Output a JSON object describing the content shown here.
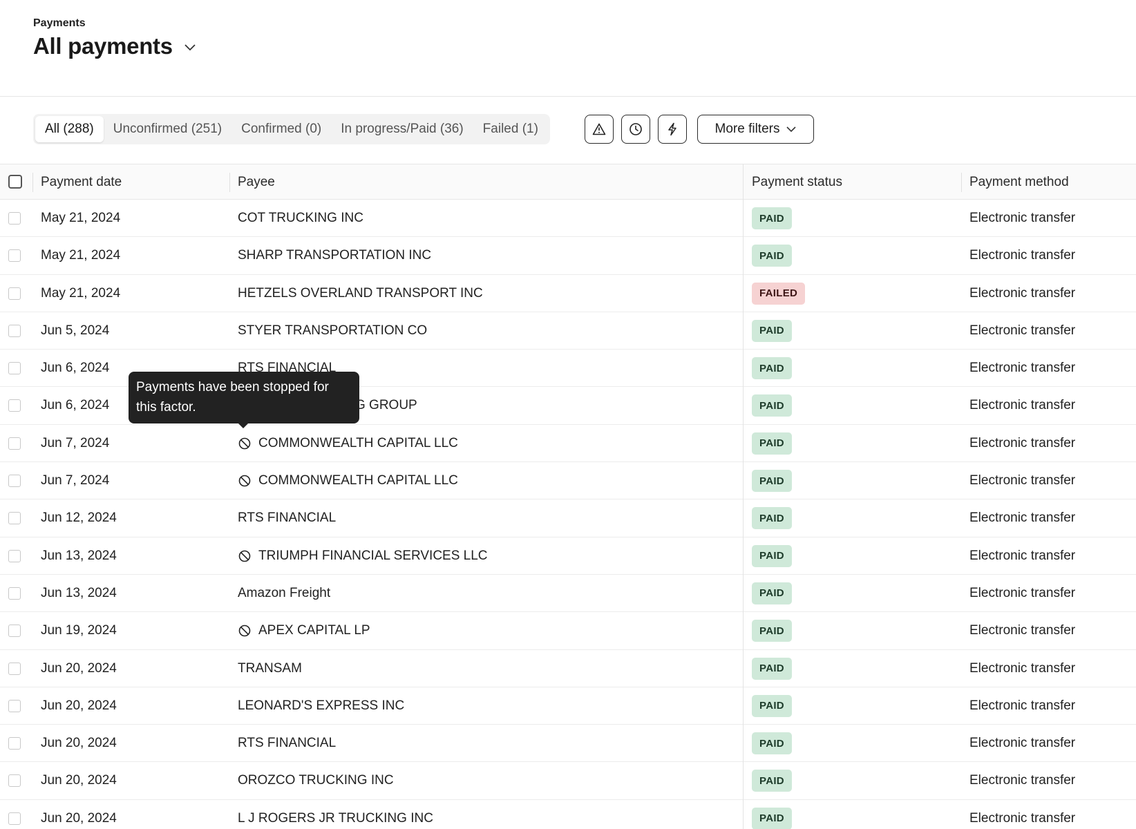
{
  "header": {
    "breadcrumb": "Payments",
    "title": "All payments"
  },
  "tabs": [
    {
      "label": "All (288)",
      "active": true
    },
    {
      "label": "Unconfirmed (251)",
      "active": false
    },
    {
      "label": "Confirmed (0)",
      "active": false
    },
    {
      "label": "In progress/Paid (36)",
      "active": false
    },
    {
      "label": "Failed (1)",
      "active": false
    }
  ],
  "filters": {
    "icons": [
      "warning-icon",
      "clock-icon",
      "bolt-icon"
    ],
    "more_filters_label": "More filters"
  },
  "table": {
    "columns": [
      "Payment date",
      "Payee",
      "Payment status",
      "Payment method"
    ],
    "rows": [
      {
        "date": "May 21, 2024",
        "payee": "COT TRUCKING INC",
        "stopped": false,
        "status": "PAID",
        "method": "Electronic transfer"
      },
      {
        "date": "May 21, 2024",
        "payee": "SHARP TRANSPORTATION INC",
        "stopped": false,
        "status": "PAID",
        "method": "Electronic transfer"
      },
      {
        "date": "May 21, 2024",
        "payee": "HETZELS OVERLAND TRANSPORT INC",
        "stopped": false,
        "status": "FAILED",
        "method": "Electronic transfer"
      },
      {
        "date": "Jun 5, 2024",
        "payee": "STYER TRANSPORTATION CO",
        "stopped": false,
        "status": "PAID",
        "method": "Electronic transfer"
      },
      {
        "date": "Jun 6, 2024",
        "payee": "RTS FINANCIAL",
        "stopped": false,
        "status": "PAID",
        "method": "Electronic transfer"
      },
      {
        "date": "Jun 6, 2024",
        "payee": "G GROUP",
        "stopped": false,
        "status": "PAID",
        "method": "Electronic transfer"
      },
      {
        "date": "Jun 7, 2024",
        "payee": "COMMONWEALTH CAPITAL LLC",
        "stopped": true,
        "status": "PAID",
        "method": "Electronic transfer"
      },
      {
        "date": "Jun 7, 2024",
        "payee": "COMMONWEALTH CAPITAL LLC",
        "stopped": true,
        "status": "PAID",
        "method": "Electronic transfer"
      },
      {
        "date": "Jun 12, 2024",
        "payee": "RTS FINANCIAL",
        "stopped": false,
        "status": "PAID",
        "method": "Electronic transfer"
      },
      {
        "date": "Jun 13, 2024",
        "payee": "TRIUMPH FINANCIAL SERVICES LLC",
        "stopped": true,
        "status": "PAID",
        "method": "Electronic transfer"
      },
      {
        "date": "Jun 13, 2024",
        "payee": "Amazon Freight",
        "stopped": false,
        "status": "PAID",
        "method": "Electronic transfer"
      },
      {
        "date": "Jun 19, 2024",
        "payee": "APEX CAPITAL LP",
        "stopped": true,
        "status": "PAID",
        "method": "Electronic transfer"
      },
      {
        "date": "Jun 20, 2024",
        "payee": "TRANSAM",
        "stopped": false,
        "status": "PAID",
        "method": "Electronic transfer"
      },
      {
        "date": "Jun 20, 2024",
        "payee": "LEONARD'S EXPRESS INC",
        "stopped": false,
        "status": "PAID",
        "method": "Electronic transfer"
      },
      {
        "date": "Jun 20, 2024",
        "payee": "RTS FINANCIAL",
        "stopped": false,
        "status": "PAID",
        "method": "Electronic transfer"
      },
      {
        "date": "Jun 20, 2024",
        "payee": "OROZCO TRUCKING INC",
        "stopped": false,
        "status": "PAID",
        "method": "Electronic transfer"
      },
      {
        "date": "Jun 20, 2024",
        "payee": "L J ROGERS JR TRUCKING INC",
        "stopped": false,
        "status": "PAID",
        "method": "Electronic transfer"
      }
    ]
  },
  "tooltip": {
    "text_line1": "Payments have been stopped for",
    "text_line2": "this factor."
  },
  "colors": {
    "paid_bg": "#cfe9d9",
    "failed_bg": "#f6d2d2",
    "tooltip_bg": "#222222"
  }
}
